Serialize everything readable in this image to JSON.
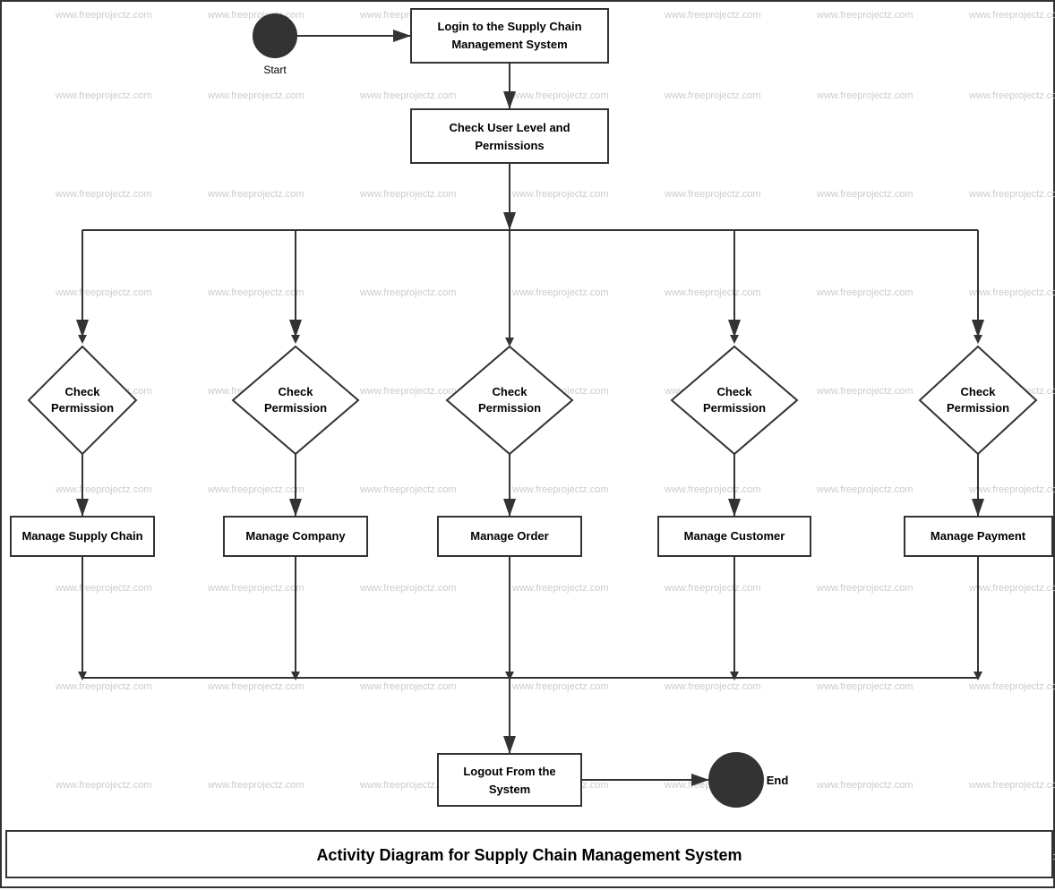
{
  "diagram": {
    "title": "Activity Diagram for Supply Chain Management System",
    "watermark": "www.freeprojectz.com",
    "nodes": {
      "start": {
        "label": "Start"
      },
      "login": {
        "label": "Login to the Supply Chain\nManagement System"
      },
      "checkPermissions": {
        "label": "Check User Level and\nPermissions"
      },
      "diamond1": {
        "label": "Check\nPermission"
      },
      "diamond2": {
        "label": "Check\nPermission"
      },
      "diamond3": {
        "label": "Check\nPermission"
      },
      "diamond4": {
        "label": "Check\nPermission"
      },
      "diamond5": {
        "label": "Check\nPermission"
      },
      "manageSupplyChain": {
        "label": "Manage Supply Chain"
      },
      "manageCompany": {
        "label": "Manage Company"
      },
      "manageOrder": {
        "label": "Manage Order"
      },
      "manageCustomer": {
        "label": "Manage Customer"
      },
      "managePayment": {
        "label": "Manage Payment"
      },
      "logout": {
        "label": "Logout From the\nSystem"
      },
      "end": {
        "label": "End"
      }
    }
  }
}
